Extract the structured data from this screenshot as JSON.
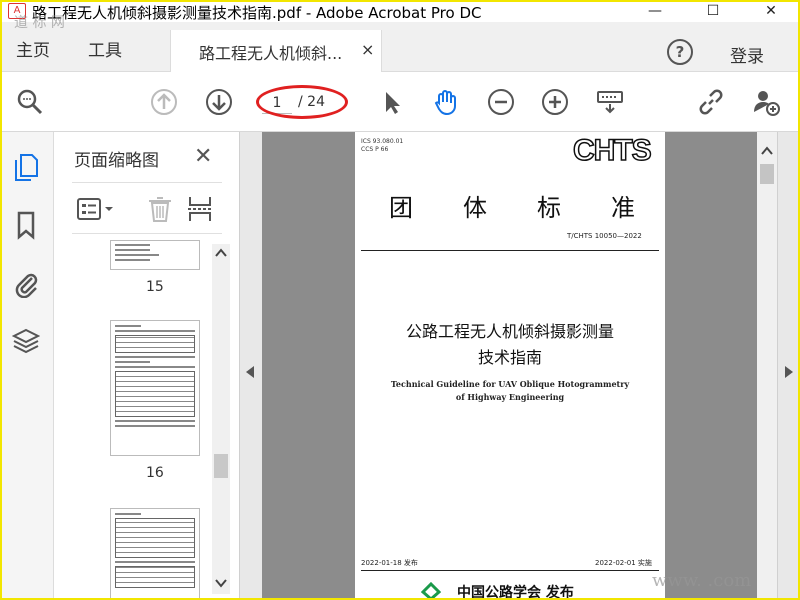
{
  "window": {
    "title": "路工程无人机倾斜摄影测量技术指南.pdf - Adobe Acrobat Pro DC",
    "minimize": "—",
    "maximize": "☐",
    "close": "✕"
  },
  "nav": {
    "home": "主页",
    "tools": "工具",
    "doc_tab": "路工程无人机倾斜...",
    "doc_tab_close": "×",
    "help": "?",
    "login": "登录"
  },
  "toolbar": {
    "page_current": "1",
    "page_total": "/ 24"
  },
  "thumbnails": {
    "title": "页面缩略图",
    "close": "✕",
    "pages": [
      "15",
      "16"
    ]
  },
  "document": {
    "ics": "ICS 93.080.01",
    "ccs": "CCS P 66",
    "logo_text": "CHTS",
    "heading_chars": [
      "团",
      "体",
      "标",
      "准"
    ],
    "std_code": "T/CHTS  10050—2022",
    "title_cn_line1": "公路工程无人机倾斜摄影测量",
    "title_cn_line2": "技术指南",
    "title_en_line1": "Technical Guideline for UAV Oblique Hotogrammetry",
    "title_en_line2": "of Highway Engineering",
    "publish_date": "2022-01-18 发布",
    "effective_date": "2022-02-01 实施",
    "organization": "中国公路学会   发布"
  },
  "watermarks": {
    "top_left": "道 标 网",
    "bottom_right": "www.     .com"
  },
  "colors": {
    "frame": "#f2e600",
    "highlight_ellipse": "#e02020",
    "accent_blue": "#1473e6"
  }
}
